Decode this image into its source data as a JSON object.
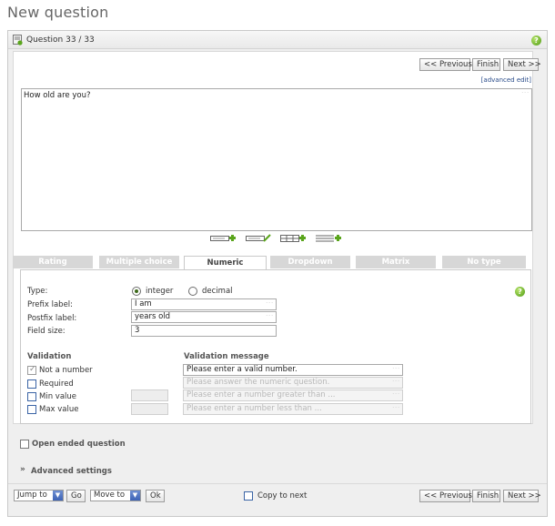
{
  "page": {
    "title": "New question"
  },
  "panel": {
    "question_label": "Question 33 / 33"
  },
  "nav": {
    "previous": "<< Previous",
    "finish": "Finish",
    "next": "Next >>"
  },
  "editor": {
    "advanced_edit": "[advanced edit]",
    "question_text": "How old are you?"
  },
  "tabs": [
    {
      "label": "Rating",
      "active": false
    },
    {
      "label": "Multiple choice",
      "active": false
    },
    {
      "label": "Numeric",
      "active": true
    },
    {
      "label": "Dropdown",
      "active": false
    },
    {
      "label": "Matrix",
      "active": false
    },
    {
      "label": "No type",
      "active": false
    }
  ],
  "numeric": {
    "type_label": "Type:",
    "type_options": [
      "integer",
      "decimal"
    ],
    "type_selected": "integer",
    "prefix_label": "Prefix label:",
    "prefix_value": "I am",
    "postfix_label": "Postfix label:",
    "postfix_value": "years old",
    "field_size_label": "Field size:",
    "field_size_value": "3"
  },
  "validation": {
    "heading": "Validation",
    "message_heading": "Validation message",
    "rules": [
      {
        "label": "Not a number",
        "checked": true,
        "message": "Please enter a valid number.",
        "enabled": true
      },
      {
        "label": "Required",
        "checked": false,
        "message": "Please answer the numeric question.",
        "enabled": false
      },
      {
        "label": "Min value",
        "checked": false,
        "message": "Please enter a number greater than ...",
        "enabled": false
      },
      {
        "label": "Max value",
        "checked": false,
        "message": "Please enter a number less than ...",
        "enabled": false
      }
    ]
  },
  "options": {
    "open_ended": "Open ended question",
    "advanced_settings": "Advanced settings"
  },
  "footer": {
    "jump_to": "Jump to",
    "go": "Go",
    "move_to": "Move to",
    "ok": "Ok",
    "copy_to_next": "Copy to next"
  },
  "icons": {
    "help": "help-icon",
    "question": "question-icon",
    "toolbar": [
      "insert-field-icon",
      "edit-field-icon",
      "insert-table-icon",
      "insert-line-icon"
    ]
  },
  "colors": {
    "accent_green": "#5aa51c",
    "link_blue": "#2a4c8a",
    "checkbox_blue": "#3a63a5"
  }
}
